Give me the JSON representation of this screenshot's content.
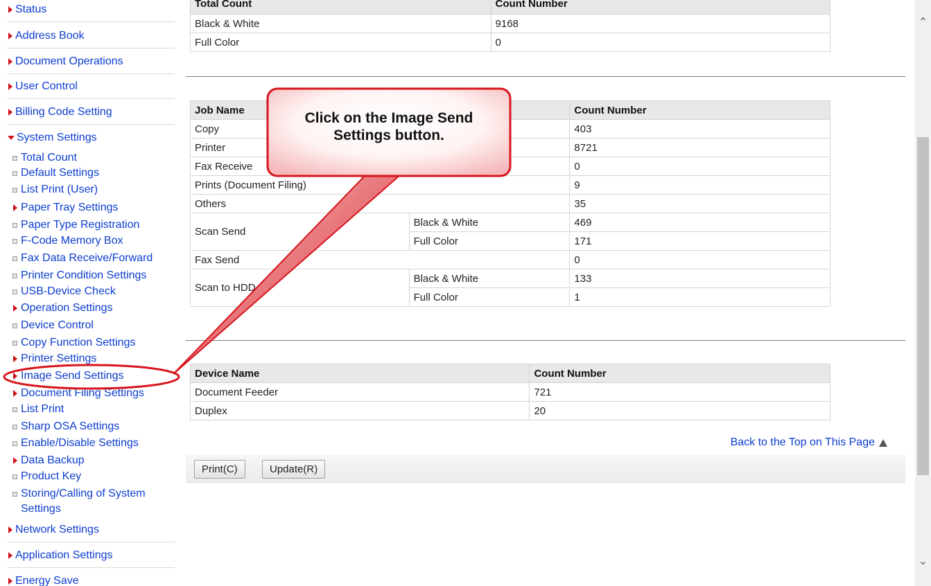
{
  "sidebar": {
    "top_items": [
      {
        "label": "Status"
      },
      {
        "label": "Address Book"
      },
      {
        "label": "Document Operations"
      },
      {
        "label": "User Control"
      },
      {
        "label": "Billing Code Setting"
      }
    ],
    "system_settings": {
      "label": "System Settings",
      "items": [
        {
          "label": "Total Count",
          "marker": "square"
        },
        {
          "label": "Default Settings",
          "marker": "square"
        },
        {
          "label": "List Print (User)",
          "marker": "square"
        },
        {
          "label": "Paper Tray Settings",
          "marker": "arrow"
        },
        {
          "label": "Paper Type Registration",
          "marker": "square"
        },
        {
          "label": "F-Code Memory Box",
          "marker": "square"
        },
        {
          "label": "Fax Data Receive/Forward",
          "marker": "square"
        },
        {
          "label": "Printer Condition Settings",
          "marker": "square"
        },
        {
          "label": "USB-Device Check",
          "marker": "square"
        },
        {
          "label": "Operation Settings",
          "marker": "arrow"
        },
        {
          "label": "Device Control",
          "marker": "square"
        },
        {
          "label": "Copy Function Settings",
          "marker": "square"
        },
        {
          "label": "Printer Settings",
          "marker": "arrow"
        },
        {
          "label": "Image Send Settings",
          "marker": "arrow"
        },
        {
          "label": "Document Filing Settings",
          "marker": "arrow"
        },
        {
          "label": "List Print",
          "marker": "square"
        },
        {
          "label": "Sharp OSA Settings",
          "marker": "square"
        },
        {
          "label": "Enable/Disable Settings",
          "marker": "square"
        },
        {
          "label": "Data Backup",
          "marker": "arrow"
        },
        {
          "label": "Product Key",
          "marker": "square"
        },
        {
          "label": "Storing/Calling of System Settings",
          "marker": "square"
        }
      ]
    },
    "bottom_items": [
      {
        "label": "Network Settings"
      },
      {
        "label": "Application Settings"
      },
      {
        "label": "Energy Save"
      }
    ]
  },
  "total_count_table": {
    "headers": [
      "Total Count",
      "Count Number"
    ],
    "rows": [
      [
        "Black & White",
        "9168"
      ],
      [
        "Full Color",
        "0"
      ]
    ]
  },
  "job_table": {
    "headers": [
      "Job Name",
      "Count Number"
    ],
    "rows": {
      "copy": [
        "Copy",
        "403"
      ],
      "printer": [
        "Printer",
        "8721"
      ],
      "fax_receive": [
        "Fax Receive",
        "0"
      ],
      "prints_doc_filing": [
        "Prints (Document Filing)",
        "9"
      ],
      "others": [
        "Others",
        "35"
      ],
      "scan_send": {
        "name": "Scan Send",
        "bw_label": "Black & White",
        "bw": "469",
        "fc_label": "Full Color",
        "fc": "171"
      },
      "fax_send": [
        "Fax Send",
        "0"
      ],
      "scan_hdd": {
        "name": "Scan to HDD",
        "bw_label": "Black & White",
        "bw": "133",
        "fc_label": "Full Color",
        "fc": "1"
      }
    }
  },
  "device_table": {
    "headers": [
      "Device Name",
      "Count Number"
    ],
    "rows": [
      [
        "Document Feeder",
        "721"
      ],
      [
        "Duplex",
        "20"
      ]
    ]
  },
  "back_to_top": "Back to the Top on This Page",
  "buttons": {
    "print": "Print(C)",
    "update": "Update(R)"
  },
  "callout": {
    "line1": "Click on the Image Send",
    "line2": "Settings button."
  },
  "colors": {
    "link": "#0b3ccf",
    "marker": "#d0121b",
    "callout_border": "#d8141c",
    "highlight_ellipse": "#d8141c"
  },
  "icons": {
    "scroll_up": "chevron-up-icon",
    "scroll_down": "chevron-down-icon",
    "back_top": "triangle-up-icon"
  }
}
